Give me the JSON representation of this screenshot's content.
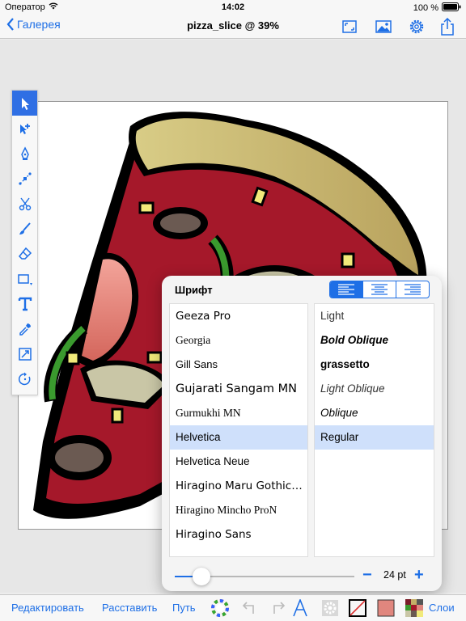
{
  "status": {
    "carrier": "Оператор",
    "time": "14:02",
    "battery": "100 %"
  },
  "nav": {
    "back_label": "Галерея",
    "title": "pizza_slice @ 39%"
  },
  "panel": {
    "title": "Шрифт",
    "fonts": [
      "Geeza Pro",
      "Georgia",
      "Gill Sans",
      "Gujarati Sangam MN",
      "Gurmukhi MN",
      "Helvetica",
      "Helvetica Neue",
      "Hiragino Maru Gothic…",
      "Hiragino Mincho ProN",
      "Hiragino Sans"
    ],
    "styles": [
      "Light",
      "Bold Oblique",
      "grassetto",
      "Light Oblique",
      "Oblique",
      "Regular"
    ],
    "size_label": "24 pt",
    "size_level_fraction": 0.1
  },
  "bottom": {
    "edit": "Редактировать",
    "arrange": "Расставить",
    "path": "Путь",
    "layers": "Слои"
  },
  "colors": {
    "accent": "#1e6fe6",
    "fill_swatch": "#e0867e",
    "crust": "#c4b067",
    "sauce": "#a5182a"
  }
}
